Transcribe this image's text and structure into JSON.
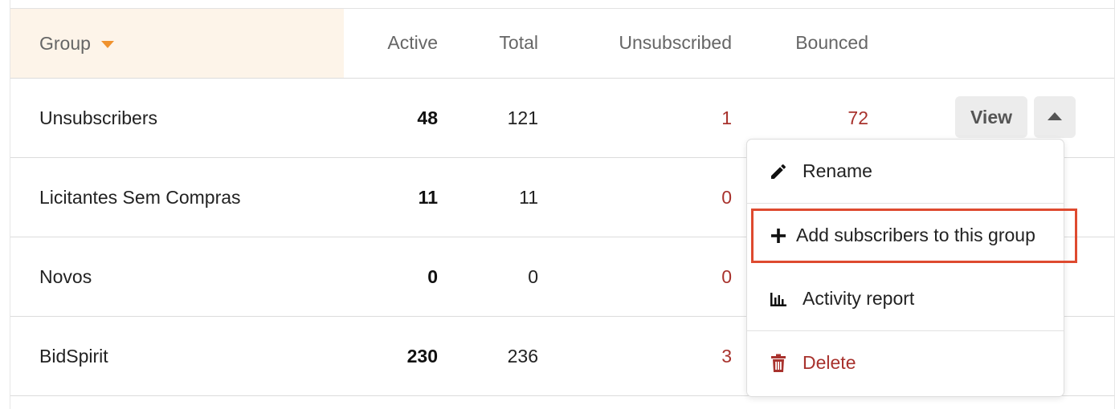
{
  "table": {
    "headers": {
      "group": "Group",
      "active": "Active",
      "total": "Total",
      "unsubscribed": "Unsubscribed",
      "bounced": "Bounced"
    },
    "rows": [
      {
        "name": "Unsubscribers",
        "active": "48",
        "total": "121",
        "unsubscribed": "1",
        "bounced": "72"
      },
      {
        "name": "Licitantes Sem Compras",
        "active": "11",
        "total": "11",
        "unsubscribed": "0",
        "bounced": ""
      },
      {
        "name": "Novos",
        "active": "0",
        "total": "0",
        "unsubscribed": "0",
        "bounced": ""
      },
      {
        "name": "BidSpirit",
        "active": "230",
        "total": "236",
        "unsubscribed": "3",
        "bounced": ""
      }
    ],
    "row_actions": {
      "view_label": "View"
    }
  },
  "dropdown": {
    "items": [
      {
        "label": "Rename",
        "icon": "pencil-icon"
      },
      {
        "label": "Add subscribers to this group",
        "icon": "plus-icon"
      },
      {
        "label": "Activity report",
        "icon": "bar-chart-icon"
      },
      {
        "label": "Delete",
        "icon": "trash-icon"
      }
    ]
  },
  "colors": {
    "sorted_header_bg": "#fdf4e9",
    "sort_caret": "#f0922e",
    "danger_text": "#a8322d",
    "highlight_border": "#de4a2f"
  }
}
